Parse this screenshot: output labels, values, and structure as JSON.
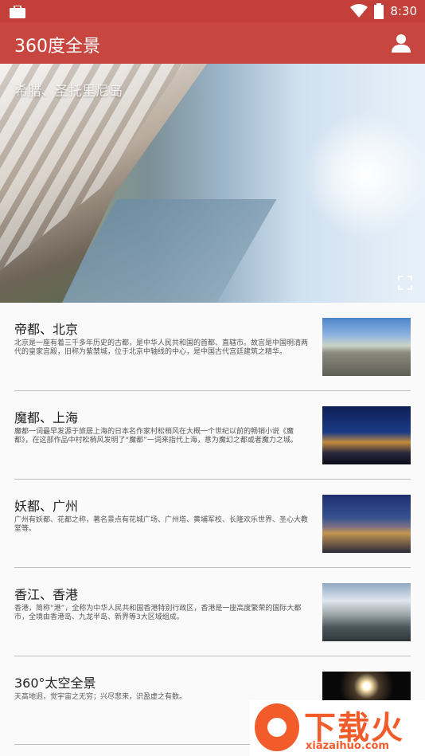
{
  "status_bar": {
    "time": "8:30",
    "icons": [
      "briefcase-icon",
      "wifi-icon",
      "battery-icon"
    ]
  },
  "app_bar": {
    "title": "360度全景",
    "profile_icon": "person-icon"
  },
  "hero": {
    "caption": "希腊、圣托里尼岛",
    "fullscreen_icon": "fullscreen-icon"
  },
  "items": [
    {
      "title": "帝都、北京",
      "desc": "北京是一座有着三千多年历史的古都，是中华人民共和国的首都、直辖市。故宫是中国明清两代的皇家宫殿，旧称为紫禁城，位于北京中轴线的中心，是中国古代宫廷建筑之精华。"
    },
    {
      "title": "魔都、上海",
      "desc": "魔都一词最早发源于旅居上海的日本名作家村松梢风在大概一个世纪以前的畅销小说《魔都》，在这部作品中村松梢风发明了“魔都”一词来指代上海，意为魔幻之都或者魔力之城。"
    },
    {
      "title": "妖都、广州",
      "desc": "广州有妖都、花都之称，著名景点有花城广场、广州塔、黄埔军校、长隆欢乐世界、圣心大教堂等。"
    },
    {
      "title": "香江、香港",
      "desc": "香港，简称“港”，全称为中华人民共和国香港特别行政区，香港是一座高度繁荣的国际大都市，全境由香港岛、九龙半岛、新界等3大区域组成。"
    },
    {
      "title": "360°太空全景",
      "desc": "天高地迥，觉宇宙之无穷；兴尽悲来，识盈虚之有数。"
    }
  ],
  "watermark": {
    "text": "下载火",
    "url": "xiazaihuo.com"
  },
  "colors": {
    "primary": "#c7463f",
    "status": "#c3403a",
    "watermark": "#f25b2a"
  }
}
